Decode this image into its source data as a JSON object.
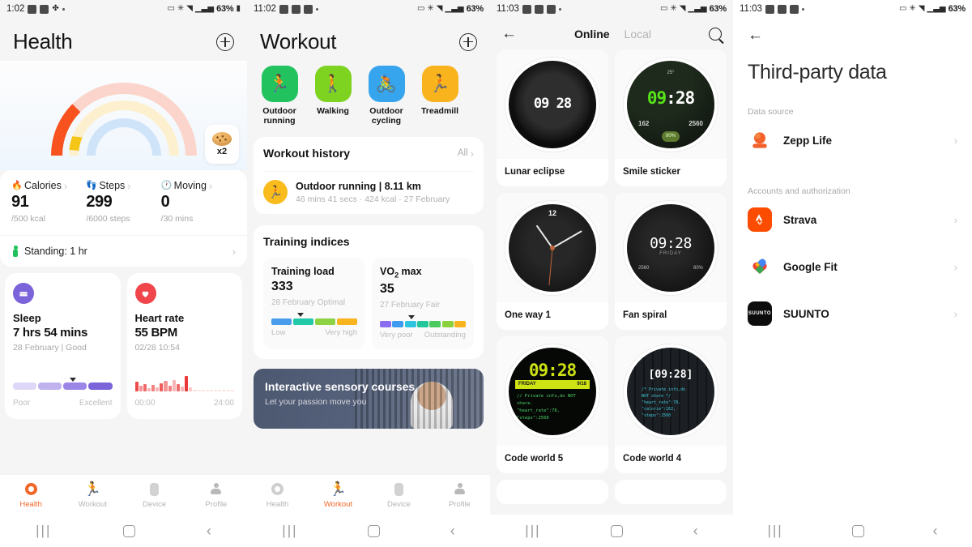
{
  "panels": {
    "health": {
      "status": {
        "time": "1:02",
        "battery": "63%"
      },
      "title": "Health",
      "add_icon": "plus-circle-icon",
      "reward": {
        "icon": "cookie-icon",
        "count": "x2"
      },
      "metrics": [
        {
          "icon": "flame-icon",
          "name": "Calories",
          "value": "91",
          "goal": "/500 kcal"
        },
        {
          "icon": "footprint-icon",
          "name": "Steps",
          "value": "299",
          "goal": "/6000 steps"
        },
        {
          "icon": "clock-icon",
          "name": "Moving",
          "value": "0",
          "goal": "/30 mins"
        }
      ],
      "standing": {
        "icon": "standing-person-icon",
        "label": "Standing: 1 hr"
      },
      "sleep": {
        "icon": "bed-icon",
        "title": "Sleep",
        "value": "7 hrs 54 mins",
        "sub": "28 February | Good",
        "scale_low": "Poor",
        "scale_high": "Excellent"
      },
      "heart": {
        "icon": "heart-icon",
        "title": "Heart rate",
        "value": "55 BPM",
        "sub": "02/28 10:54",
        "axis_start": "00:00",
        "axis_end": "24:00"
      },
      "tabs": [
        {
          "icon": "health-ring-icon",
          "label": "Health",
          "active": true
        },
        {
          "icon": "runner-icon",
          "label": "Workout",
          "active": false
        },
        {
          "icon": "device-icon",
          "label": "Device",
          "active": false
        },
        {
          "icon": "profile-icon",
          "label": "Profile",
          "active": false
        }
      ]
    },
    "workout": {
      "status": {
        "time": "11:02",
        "battery": "63%"
      },
      "title": "Workout",
      "add_icon": "plus-circle-icon",
      "types": [
        {
          "icon": "outdoor-running-icon",
          "label": "Outdoor running",
          "color": "#22c35e"
        },
        {
          "icon": "walking-icon",
          "label": "Walking",
          "color": "#7ed321"
        },
        {
          "icon": "cycling-icon",
          "label": "Outdoor cycling",
          "color": "#37a5ee"
        },
        {
          "icon": "treadmill-icon",
          "label": "Treadmill",
          "color": "#f9b31c"
        }
      ],
      "history": {
        "title": "Workout history",
        "all_label": "All",
        "entry_title": "Outdoor running | 8.11 km",
        "entry_sub": "46 mins 41 secs · 424 kcal · 27 February"
      },
      "indices": {
        "title": "Training indices",
        "cards": [
          {
            "name": "Training load",
            "value": "333",
            "date": "28 February Optimal",
            "low": "Low",
            "high": "Very high",
            "marker_pct": 33
          },
          {
            "name_pre": "VO",
            "name_sub": "2",
            "name_post": " max",
            "name": "VO2 max",
            "value": "35",
            "date": "27 February Fair",
            "low": "Very poor",
            "high": "Outstanding",
            "marker_pct": 36
          }
        ]
      },
      "banner": {
        "title": "Interactive sensory courses",
        "subtitle": "Let your passion move you"
      },
      "tabs": [
        {
          "icon": "health-ring-icon",
          "label": "Health",
          "active": false
        },
        {
          "icon": "runner-icon",
          "label": "Workout",
          "active": true
        },
        {
          "icon": "device-icon",
          "label": "Device",
          "active": false
        },
        {
          "icon": "profile-icon",
          "label": "Profile",
          "active": false
        }
      ]
    },
    "watchfaces": {
      "status": {
        "time": "11:03",
        "battery": "63%"
      },
      "back_icon": "back-arrow-icon",
      "search_icon": "search-icon",
      "tabs": [
        {
          "label": "Online",
          "active": true
        },
        {
          "label": "Local",
          "active": false
        }
      ],
      "items": [
        {
          "name": "Lunar eclipse",
          "time": "09 28",
          "style": "lunar"
        },
        {
          "name": "Smile sticker",
          "time": "09:28",
          "style": "smile",
          "kcal": "162",
          "steps": "2560",
          "battery": "80%",
          "temp": "25°"
        },
        {
          "name": "One way 1",
          "time": "",
          "style": "analog",
          "marker12": "12"
        },
        {
          "name": "Fan spiral",
          "time": "09:28",
          "style": "fan",
          "day": "FRIDAY"
        },
        {
          "name": "Code world 5",
          "time": "09:28",
          "style": "code5",
          "day": "FRIDAY"
        },
        {
          "name": "Code world 4",
          "time": "[09:28]",
          "style": "code4"
        }
      ]
    },
    "thirdparty": {
      "status": {
        "time": "11:03",
        "battery": "63%"
      },
      "back_icon": "back-arrow-icon",
      "title": "Third-party data",
      "sections": [
        {
          "label": "Data source",
          "rows": [
            {
              "icon": "zepp-life-icon",
              "label": "Zepp Life"
            }
          ]
        },
        {
          "label": "Accounts and authorization",
          "rows": [
            {
              "icon": "strava-icon",
              "label": "Strava"
            },
            {
              "icon": "google-fit-icon",
              "label": "Google Fit"
            },
            {
              "icon": "suunto-icon",
              "label": "SUUNTO"
            }
          ]
        }
      ]
    }
  },
  "colors": {
    "accent_orange": "#f0672a",
    "calories_arc": "#f8521f",
    "steps_arc": "#f5c518",
    "arc_outer_bg": "#fbd5cb",
    "arc_mid_bg": "#fdf0cf",
    "arc_inner_bg": "#cfe4f8",
    "heart_red": "#f0464b",
    "sleep_purple": "#7b63d9"
  },
  "navbar": {
    "recent": "|||",
    "home": "home-square-icon",
    "back": "back-chevron-icon"
  }
}
